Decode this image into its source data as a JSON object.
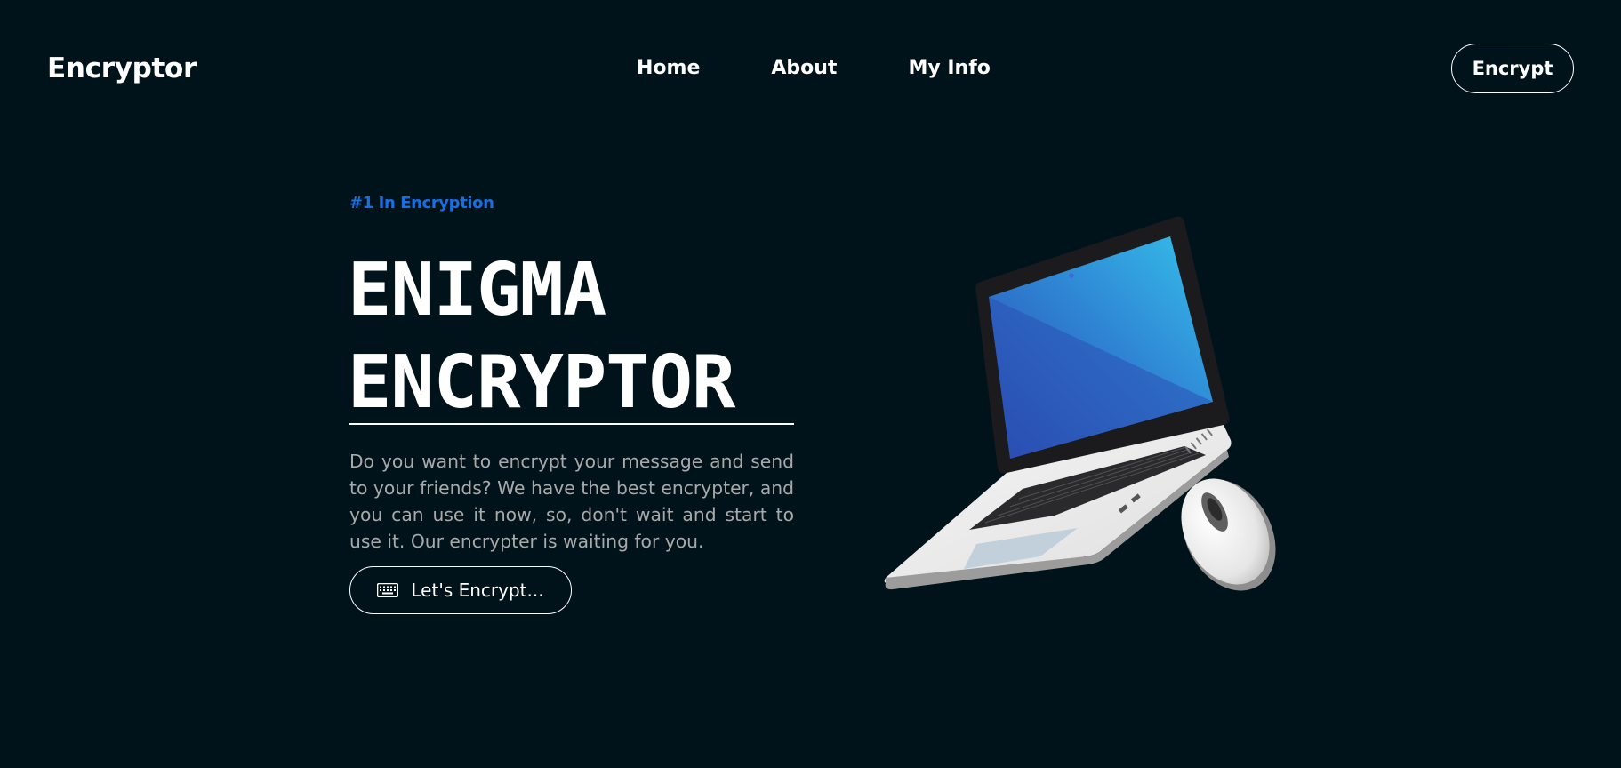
{
  "header": {
    "logo": "Encryptor",
    "nav": [
      {
        "label": "Home"
      },
      {
        "label": "About"
      },
      {
        "label": "My Info"
      }
    ],
    "cta_label": "Encrypt"
  },
  "hero": {
    "tagline": "#1 In Encryption",
    "title_line1": "ENIGMA",
    "title_line2": "ENCRYPTOR",
    "description": "Do you want to encrypt your message and send to your friends? We have the best encrypter, and you can use it now, so, don't wait and start to use it. Our encrypter is waiting for you.",
    "button_label": "Let's Encrypt...",
    "button_icon": "keyboard-icon"
  },
  "colors": {
    "background": "#00131a",
    "accent": "#1a6ee0",
    "text": "#ffffff",
    "muted_text": "#a9a9a9"
  }
}
